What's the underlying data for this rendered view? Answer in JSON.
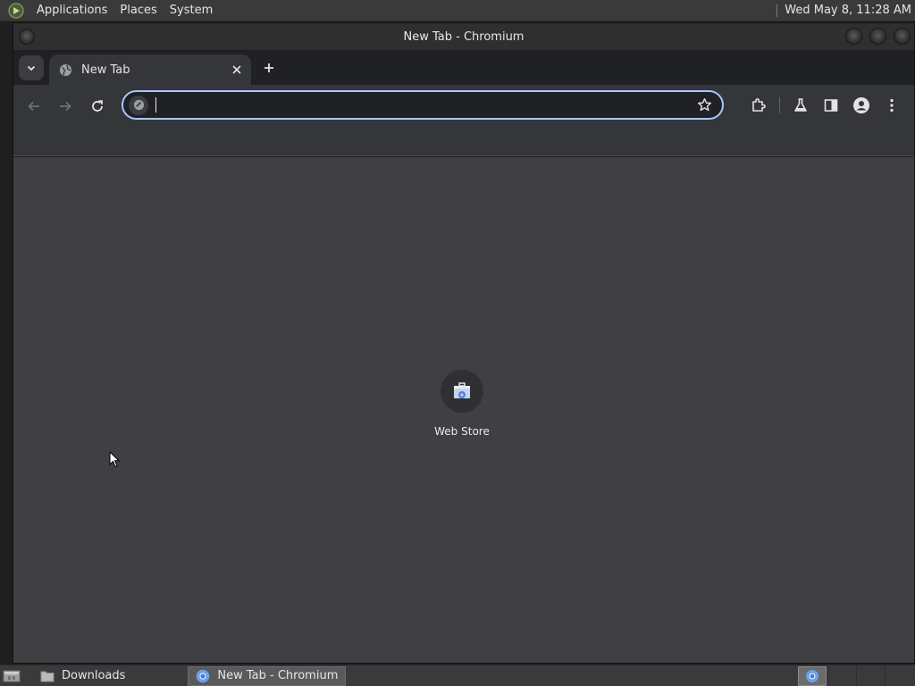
{
  "top_panel": {
    "menus": [
      "Applications",
      "Places",
      "System"
    ],
    "clock": "Wed May  8, 11:28 AM"
  },
  "window": {
    "title": "New Tab - Chromium"
  },
  "tabs": [
    {
      "title": "New Tab",
      "icon": "globe-icon"
    }
  ],
  "toolbar": {
    "omnibox_value": "",
    "icons": [
      "back-icon",
      "forward-icon",
      "reload-icon",
      "star-icon",
      "extensions-icon",
      "labs-icon",
      "side-panel-icon",
      "profile-icon",
      "menu-icon"
    ]
  },
  "new_tab_page": {
    "shortcuts": [
      {
        "label": "Web Store",
        "icon": "web-store-icon"
      }
    ]
  },
  "bottom_panel": {
    "tasks": [
      {
        "label": "Downloads",
        "icon": "folder-icon"
      },
      {
        "label": "New Tab - Chromium",
        "icon": "chromium-icon"
      }
    ]
  },
  "colors": {
    "omnibox_focus": "#a8c7fa",
    "content_bg": "#3f3f44",
    "toolbar_bg": "#35363a"
  }
}
